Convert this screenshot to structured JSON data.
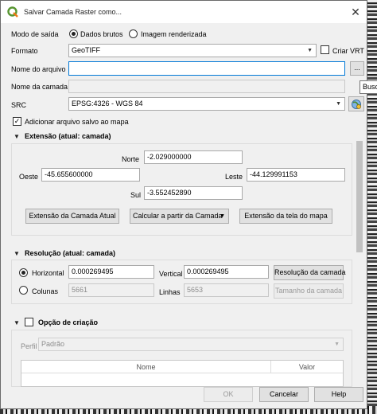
{
  "window": {
    "title": "Salvar Camada Raster como..."
  },
  "modo": {
    "label": "Modo de saída",
    "options": [
      "Dados brutos",
      "Imagem renderizada"
    ],
    "selected": "Dados brutos"
  },
  "formato": {
    "label": "Formato",
    "value": "GeoTIFF",
    "vrt_label": "Criar VRT"
  },
  "arquivo": {
    "label": "Nome do arquivo",
    "value": "",
    "browse": "...",
    "tooltip": "Busc"
  },
  "camada": {
    "label": "Nome da camada",
    "value": ""
  },
  "src": {
    "label": "SRC",
    "value": "EPSG:4326 - WGS 84"
  },
  "adicionar": {
    "label": "Adicionar arquivo salvo ao mapa",
    "checked": true
  },
  "extensao": {
    "title": "Extensão (atual: camada)",
    "norte_label": "Norte",
    "norte": "-2.029000000",
    "oeste_label": "Oeste",
    "oeste": "-45.655600000",
    "leste_label": "Leste",
    "leste": "-44.129991153",
    "sul_label": "Sul",
    "sul": "-3.552452890",
    "btn_camada": "Extensão da Camada Atual",
    "btn_calcular": "Calcular a partir da Camada",
    "btn_tela": "Extensão da tela do mapa"
  },
  "resolucao": {
    "title": "Resolução (atual: camada)",
    "horizontal_label": "Horizontal",
    "horizontal": "0.000269495",
    "vertical_label": "Vertical",
    "vertical": "0.000269495",
    "btn_resolucao": "Resolução da camada",
    "colunas_label": "Colunas",
    "colunas": "5661",
    "linhas_label": "Linhas",
    "linhas": "5653",
    "btn_tamanho": "Tamanho da camada"
  },
  "criacao": {
    "title": "Opção de criação",
    "perfil_label": "Perfil",
    "perfil": "Padrão",
    "col_nome": "Nome",
    "col_valor": "Valor"
  },
  "footer": {
    "ok": "OK",
    "cancel": "Cancelar",
    "help": "Help"
  }
}
